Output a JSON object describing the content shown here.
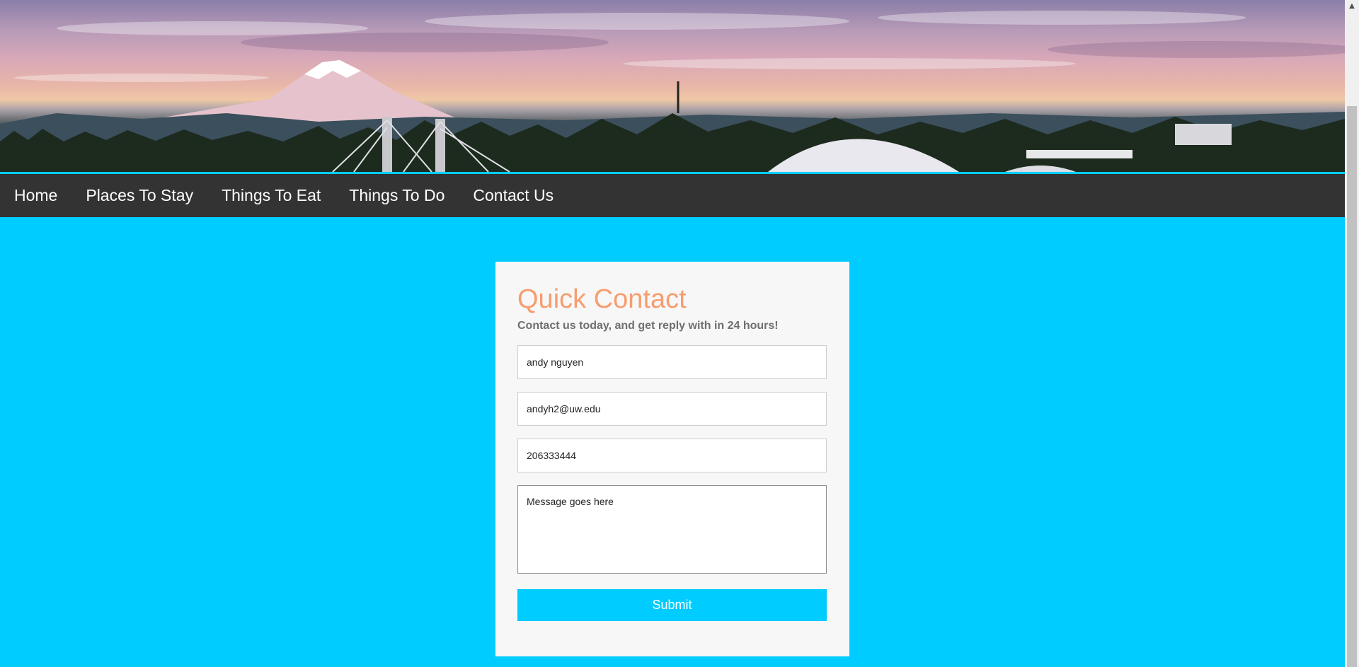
{
  "hero": {
    "image_semantic": "tacoma-skyline-with-mount-rainier-at-sunset"
  },
  "nav": {
    "items": [
      {
        "label": "Home"
      },
      {
        "label": "Places To Stay"
      },
      {
        "label": "Things To Eat"
      },
      {
        "label": "Things To Do"
      },
      {
        "label": "Contact Us"
      }
    ]
  },
  "contact": {
    "title": "Quick Contact",
    "subtitle": "Contact us today, and get reply with in 24 hours!",
    "name_value": "andy nguyen",
    "email_value": "andyh2@uw.edu",
    "phone_value": "206333444",
    "message_value": "Message goes here",
    "submit_label": "Submit"
  },
  "colors": {
    "accent": "#00ccff",
    "nav_bg": "#333333",
    "title": "#f79d6e",
    "card_bg": "#f7f7f7"
  },
  "scrollbar": {
    "up_icon": "triangle-up-icon"
  }
}
